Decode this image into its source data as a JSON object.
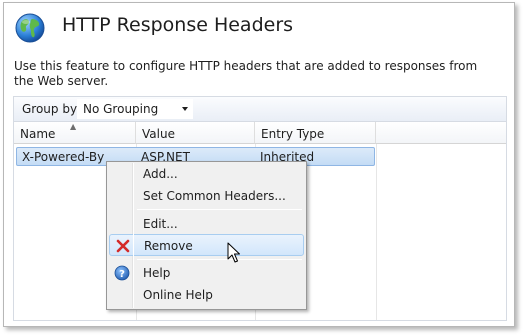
{
  "header": {
    "title": "HTTP Response Headers",
    "icon": "globe-icon"
  },
  "description": "Use this feature to configure HTTP headers that are added to responses from the Web server.",
  "toolbar": {
    "group_by_label": "Group by:",
    "group_by_value": "No Grouping"
  },
  "grid": {
    "columns": [
      "Name",
      "Value",
      "Entry Type"
    ],
    "rows": [
      {
        "name": "X-Powered-By",
        "value": "ASP.NET",
        "entry_type": "Inherited",
        "selected": true
      }
    ]
  },
  "context_menu": {
    "items": [
      {
        "label": "Add...",
        "icon": null
      },
      {
        "label": "Set Common Headers...",
        "icon": null
      },
      {
        "label": "Edit...",
        "icon": null
      },
      {
        "label": "Remove",
        "icon": "remove-x-icon",
        "hovered": true
      },
      {
        "label": "Help",
        "icon": "help-icon"
      },
      {
        "label": "Online Help",
        "icon": null
      }
    ]
  },
  "colors": {
    "selection": "#c4dcf5",
    "remove_icon": "#d42a2a",
    "help_icon": "#2f6fbf"
  }
}
